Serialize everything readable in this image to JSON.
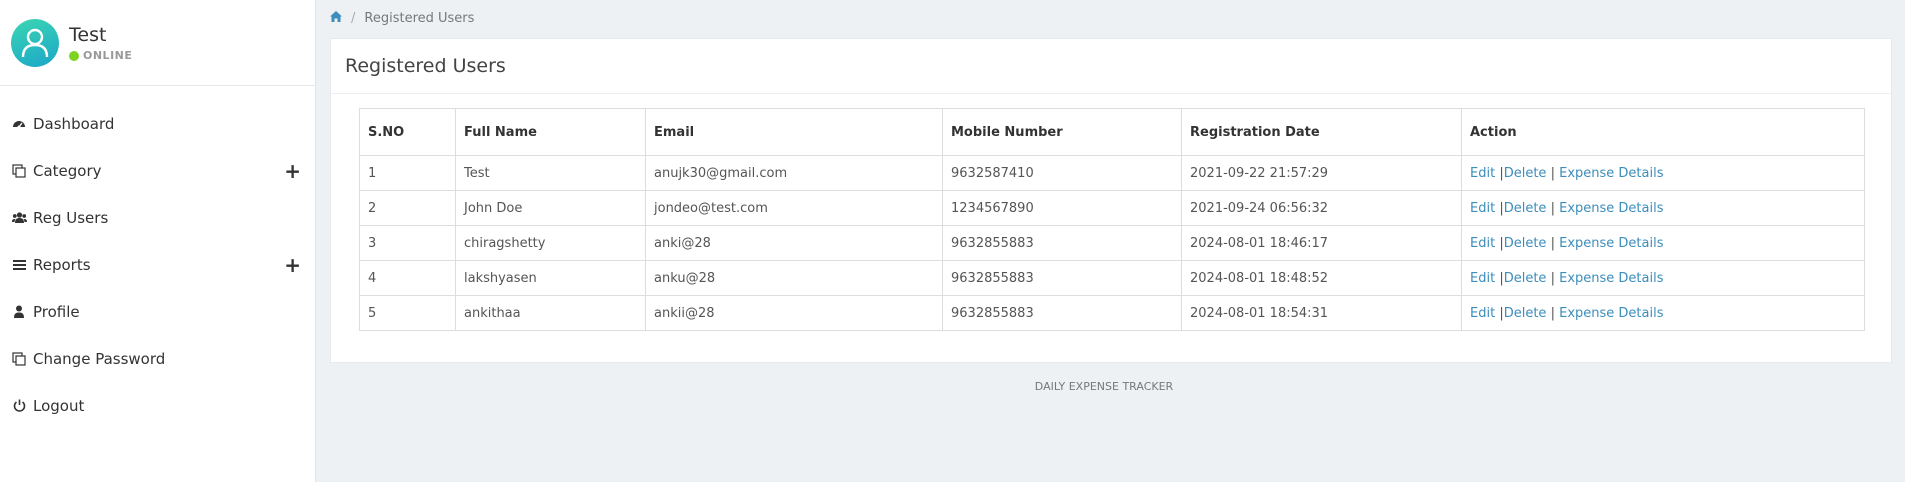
{
  "profile": {
    "name": "Test",
    "status": "ONLINE"
  },
  "sidebar": {
    "items": [
      {
        "label": "Dashboard",
        "icon": "dashboard-icon",
        "expandable": false
      },
      {
        "label": "Category",
        "icon": "copy-icon",
        "expandable": true
      },
      {
        "label": "Reg Users",
        "icon": "users-icon",
        "expandable": false
      },
      {
        "label": "Reports",
        "icon": "list-icon",
        "expandable": true
      },
      {
        "label": "Profile",
        "icon": "user-icon",
        "expandable": false
      },
      {
        "label": "Change Password",
        "icon": "copy-icon",
        "expandable": false
      },
      {
        "label": "Logout",
        "icon": "power-icon",
        "expandable": false
      }
    ],
    "expand_symbol": "+"
  },
  "breadcrumb": {
    "home_icon": "home-icon",
    "separator": "/",
    "current": "Registered Users"
  },
  "panel": {
    "title": "Registered Users"
  },
  "table": {
    "headers": [
      "S.NO",
      "Full Name",
      "Email",
      "Mobile Number",
      "Registration Date",
      "Action"
    ],
    "rows": [
      {
        "sno": "1",
        "name": "Test",
        "email": "anujk30@gmail.com",
        "mobile": "9632587410",
        "date": "2021-09-22 21:57:29"
      },
      {
        "sno": "2",
        "name": "John Doe",
        "email": "jondeo@test.com",
        "mobile": "1234567890",
        "date": "2021-09-24 06:56:32"
      },
      {
        "sno": "3",
        "name": "chiragshetty",
        "email": "anki@28",
        "mobile": "9632855883",
        "date": "2024-08-01 18:46:17"
      },
      {
        "sno": "4",
        "name": "lakshyasen",
        "email": "anku@28",
        "mobile": "9632855883",
        "date": "2024-08-01 18:48:52"
      },
      {
        "sno": "5",
        "name": "ankithaa",
        "email": "ankii@28",
        "mobile": "9632855883",
        "date": "2024-08-01 18:54:31"
      }
    ],
    "actions": {
      "edit": "Edit",
      "delete": "Delete",
      "details": "Expense Details",
      "sep": "|"
    }
  },
  "footer": {
    "text": "DAILY EXPENSE TRACKER"
  },
  "colors": {
    "link": "#3c8dbc",
    "online": "#7ed321",
    "avatar_from": "#3cd6b2",
    "avatar_to": "#1aa6c9"
  }
}
